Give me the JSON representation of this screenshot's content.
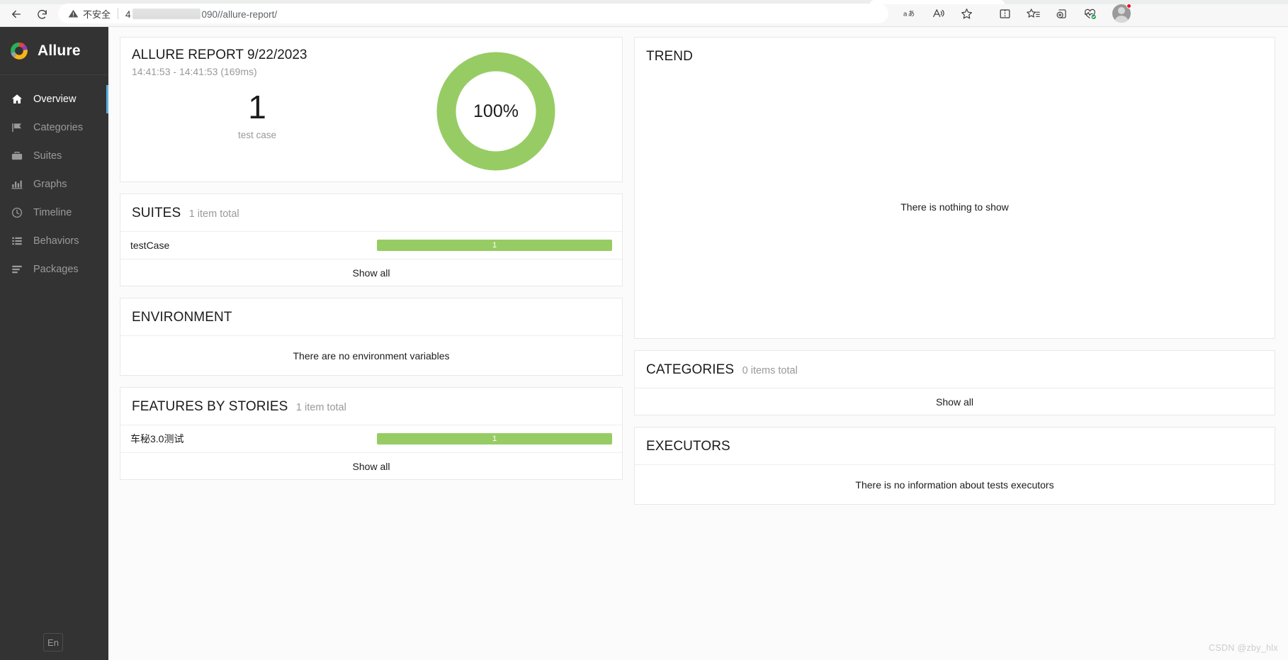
{
  "browser": {
    "security_label": "不安全",
    "url_prefix": "4",
    "url_suffix": "090//allure-report/",
    "icons": {
      "back": "back-arrow-icon",
      "reload": "reload-icon",
      "warning": "warning-triangle-icon",
      "read_aloud": "read-aloud-icon",
      "immersive_reader": "immersive-reader-icon",
      "favorite": "star-icon",
      "split_screen": "split-screen-icon",
      "favorites_bar": "favorites-list-icon",
      "collections": "collections-icon",
      "browser_essentials": "browser-essentials-icon",
      "profile": "profile-avatar-icon"
    }
  },
  "sidebar": {
    "brand": "Allure",
    "language": "En",
    "items": [
      {
        "label": "Overview",
        "icon": "home-icon",
        "active": true
      },
      {
        "label": "Categories",
        "icon": "flag-icon",
        "active": false
      },
      {
        "label": "Suites",
        "icon": "briefcase-icon",
        "active": false
      },
      {
        "label": "Graphs",
        "icon": "bar-chart-icon",
        "active": false
      },
      {
        "label": "Timeline",
        "icon": "clock-icon",
        "active": false
      },
      {
        "label": "Behaviors",
        "icon": "list-icon",
        "active": false
      },
      {
        "label": "Packages",
        "icon": "stack-icon",
        "active": false
      }
    ]
  },
  "summary": {
    "title": "ALLURE REPORT 9/22/2023",
    "time_range": "14:41:53 - 14:41:53 (169ms)",
    "count": "1",
    "count_label": "test case",
    "percent": "100%"
  },
  "suites": {
    "title": "SUITES",
    "subtitle": "1 item total",
    "rows": [
      {
        "label": "testCase",
        "value": "1",
        "percent": 100
      }
    ],
    "show_all": "Show all"
  },
  "environment": {
    "title": "ENVIRONMENT",
    "empty": "There are no environment variables"
  },
  "features": {
    "title": "FEATURES BY STORIES",
    "subtitle": "1 item total",
    "rows": [
      {
        "label": "车秘3.0测试",
        "value": "1",
        "percent": 100
      }
    ],
    "show_all": "Show all"
  },
  "trend": {
    "title": "TREND",
    "empty": "There is nothing to show"
  },
  "categories": {
    "title": "CATEGORIES",
    "subtitle": "0 items total",
    "show_all": "Show all"
  },
  "executors": {
    "title": "EXECUTORS",
    "empty": "There is no information about tests executors"
  },
  "watermark": "CSDN @zby_hlx",
  "colors": {
    "passed": "#97cc64",
    "sidebar": "#333333",
    "accent": "#5aaee0"
  },
  "chart_data": {
    "type": "pie",
    "title": "Test results distribution",
    "categories": [
      "Passed"
    ],
    "values": [
      1
    ],
    "percentages": [
      100
    ],
    "colors": [
      "#97cc64"
    ],
    "center_label": "100%",
    "total": 1,
    "legend": "none"
  }
}
